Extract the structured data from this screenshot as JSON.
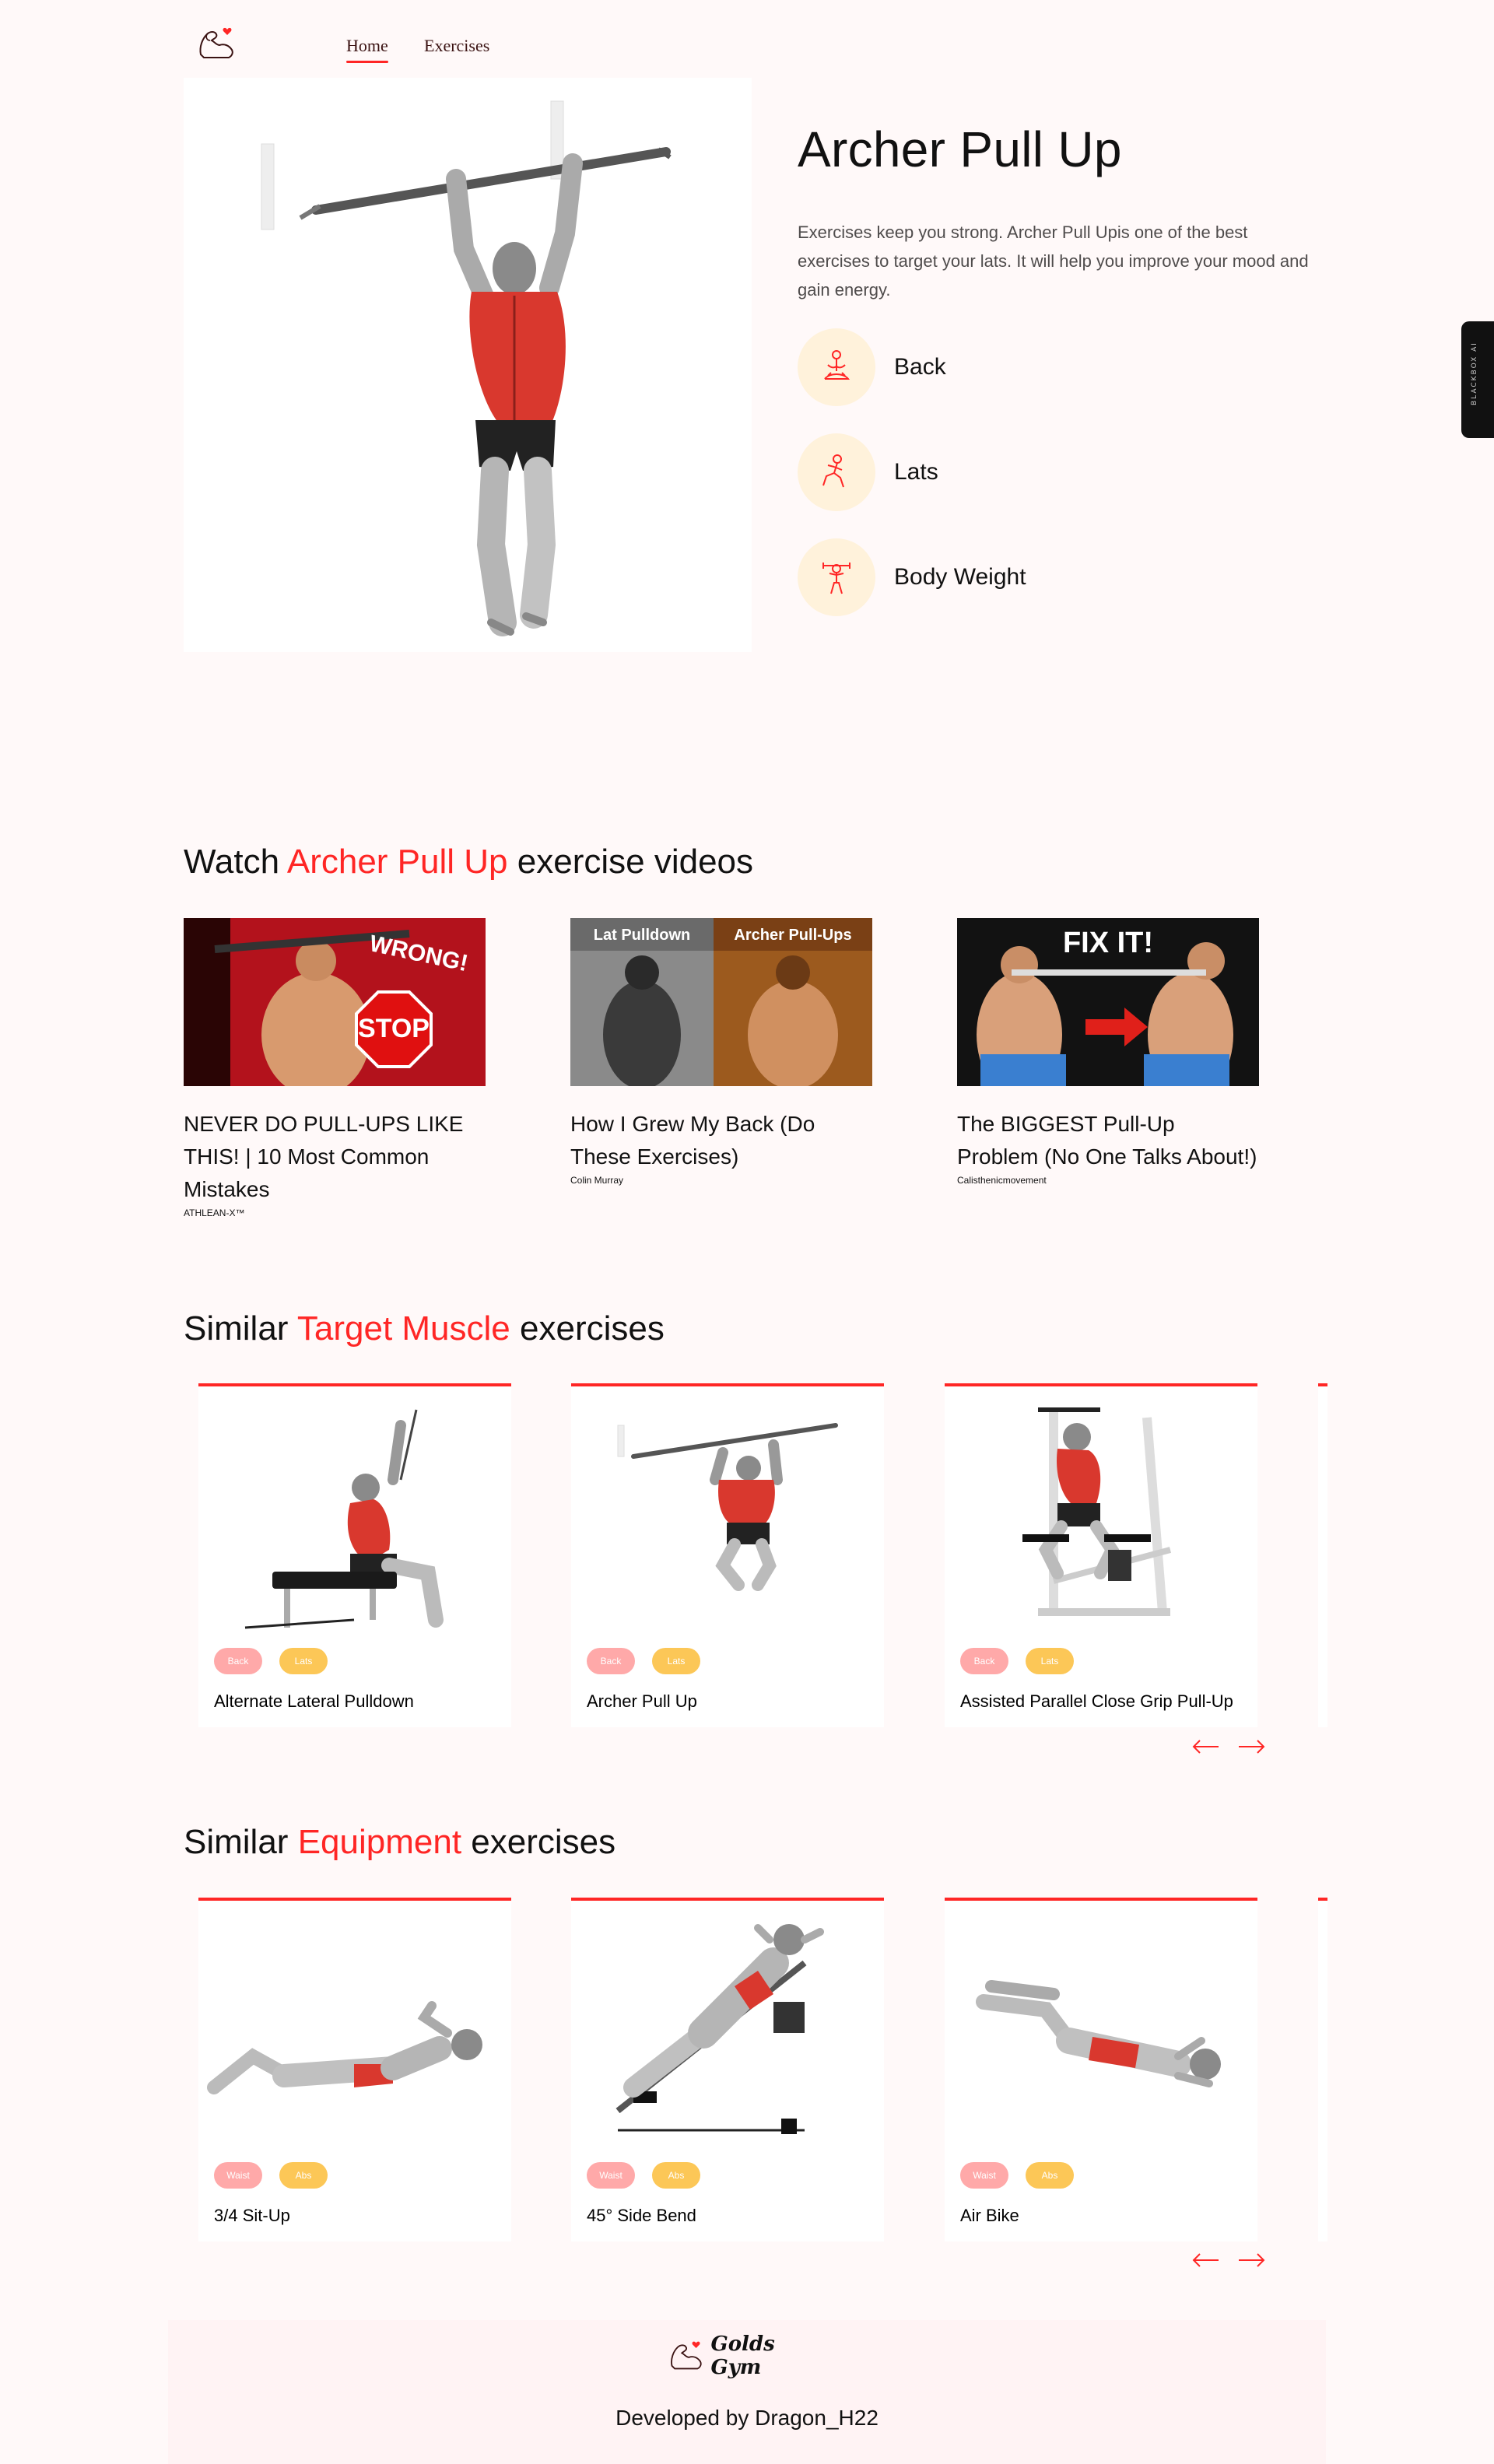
{
  "nav": {
    "logo_alt": "Golds Gym logo",
    "home_label": "Home",
    "exercises_label": "Exercises"
  },
  "hero": {
    "title": "Archer Pull Up",
    "description": "Exercises keep you strong. Archer Pull Upis one of the best exercises to target your lats. It will help you improve your mood and gain energy.",
    "features": [
      {
        "label": "Back",
        "icon": "body-part-icon"
      },
      {
        "label": "Lats",
        "icon": "target-icon"
      },
      {
        "label": "Body Weight",
        "icon": "equipment-icon"
      }
    ]
  },
  "sidebar_tab": {
    "label": "BLACKBOX AI"
  },
  "videos_section": {
    "title_prefix": "Watch ",
    "title_accent": "Archer Pull Up",
    "title_suffix": " exercise videos",
    "videos": [
      {
        "title": "NEVER DO PULL-UPS LIKE THIS! | 10 Most Common Mistakes",
        "channel": "ATHLEAN-X™",
        "thumb_text_1": "WRONG!",
        "thumb_text_2": "STOP"
      },
      {
        "title": "How I Grew My Back (Do These Exercises)",
        "channel": "Colin Murray",
        "thumb_text_1": "Lat Pulldown",
        "thumb_text_2": "Archer Pull-Ups"
      },
      {
        "title": "The BIGGEST Pull-Up Problem (No One Talks About!)",
        "channel": "Calisthenicmovement",
        "thumb_text_1": "FIX IT!",
        "thumb_text_2": ""
      }
    ]
  },
  "target_section": {
    "title_prefix": "Similar ",
    "title_accent": "Target Muscle",
    "title_suffix": " exercises",
    "cards": [
      {
        "name": "Alternate Lateral Pulldown",
        "body_part": "Back",
        "target": "Lats"
      },
      {
        "name": "Archer Pull Up",
        "body_part": "Back",
        "target": "Lats"
      },
      {
        "name": "Assisted Parallel Close Grip Pull-Up",
        "body_part": "Back",
        "target": "Lats"
      }
    ],
    "prev_arrow": "←",
    "next_arrow": "→"
  },
  "equipment_section": {
    "title_prefix": "Similar ",
    "title_accent": "Equipment",
    "title_suffix": " exercises",
    "cards": [
      {
        "name": "3/4 Sit-Up",
        "body_part": "Waist",
        "target": "Abs"
      },
      {
        "name": "45° Side Bend",
        "body_part": "Waist",
        "target": "Abs"
      },
      {
        "name": "Air Bike",
        "body_part": "Waist",
        "target": "Abs"
      }
    ],
    "prev_arrow": "←",
    "next_arrow": "→"
  },
  "footer": {
    "brand": "Golds Gym",
    "developed_by": "Developed by Dragon_H22"
  },
  "colors": {
    "accent": "#ff2625",
    "pill_target": "#ffa9a9",
    "pill_body": "#fcc757",
    "feature_bg": "#fff2db",
    "page_bg": "#fff9f9"
  }
}
